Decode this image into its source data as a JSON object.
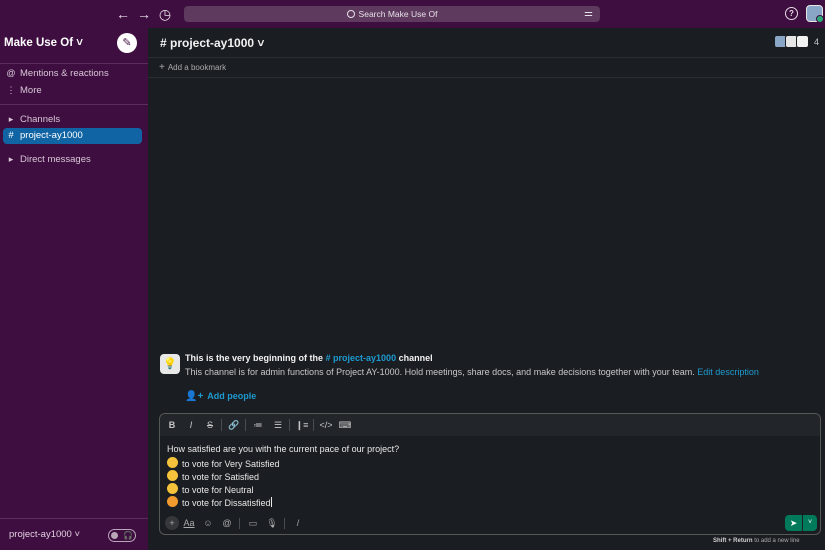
{
  "topbar": {
    "back_icon": "←",
    "forward_icon": "→",
    "history_icon": "◷",
    "search_placeholder": "Search Make Use Of",
    "filter_icon": "⚌",
    "help_icon": "?"
  },
  "sidebar": {
    "workspace": "Make Use Of ˅",
    "compose_icon": "✎",
    "mentions": {
      "icon": "@",
      "label": "Mentions & reactions"
    },
    "more": {
      "icon": "⋮",
      "label": "More"
    },
    "channels": {
      "icon": "▸",
      "label": "Channels"
    },
    "active_channel": {
      "icon": "#",
      "label": "project-ay1000"
    },
    "dms": {
      "icon": "▸",
      "label": "Direct messages"
    },
    "footer_channel": "project-ay1000 ˅",
    "huddle_icon": "🎧"
  },
  "channel": {
    "title": "# project-ay1000 ˅",
    "member_count": "4",
    "bookmark_plus": "+",
    "bookmark_label": "Add a bookmark"
  },
  "intro": {
    "icon": "💡",
    "title_prefix": "This is the very beginning of the",
    "title_link": "# project-ay1000",
    "title_suffix": "channel",
    "description": "This channel is for admin functions of Project AY-1000. Hold meetings, share docs, and make decisions together with your team.",
    "edit_link": "Edit description",
    "add_people_icon": "👤+",
    "add_people": "Add people"
  },
  "composer": {
    "format_buttons": {
      "bold": "B",
      "italic": "I",
      "strike": "S",
      "link": "🔗",
      "ordered_list": "≔",
      "bullet_list": "☰",
      "blockquote": "❙≡",
      "code": "</>",
      "code_block": "⌨"
    },
    "lines": [
      {
        "text": "How satisfied are you with the current pace of our project?"
      },
      {
        "emoji": "😁",
        "text": "to vote for Very Satisfied"
      },
      {
        "emoji": "🙂",
        "text": "to vote for Satisfied"
      },
      {
        "emoji": "😐",
        "text": "to vote for Neutral"
      },
      {
        "emoji": "😠",
        "text": "to vote for Dissatisfied"
      }
    ],
    "controls": {
      "plus": "+",
      "format": "Aa",
      "emoji": "☺",
      "mention": "@",
      "video": "▭",
      "audio": "🎙",
      "shortcuts": "/"
    },
    "send_icon": "➤",
    "send_more_icon": "˅",
    "hint_key": "Shift + Return",
    "hint_text": "to add a new line"
  },
  "colors": {
    "sidebar": "#3f0e40",
    "active": "#1164a3",
    "link": "#1d9bd1",
    "send": "#007a5a"
  }
}
